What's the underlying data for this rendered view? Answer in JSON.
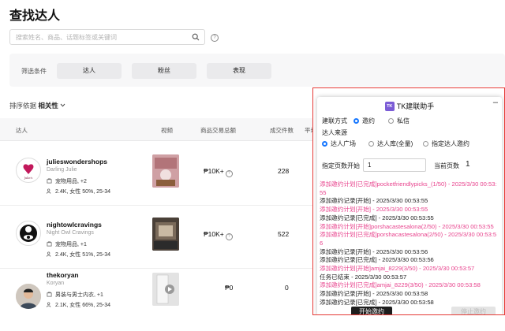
{
  "page": {
    "title": "查找达人"
  },
  "search": {
    "placeholder": "搜索姓名、商品、话题标签或关键词"
  },
  "filters": {
    "label": "筛选条件",
    "buttons": [
      "达人",
      "粉丝",
      "表现"
    ]
  },
  "sort": {
    "label": "排序依据",
    "value": "相关性"
  },
  "table": {
    "headers": [
      "达人",
      "视频",
      "商品交易总额",
      "成交件数",
      "平均"
    ],
    "rows": [
      {
        "handle": "julieswondershops",
        "nickname": "Darling Julie",
        "category": "宠物用品, +2",
        "audience": "2.4K, 女性 50%, 25-34",
        "gmv": "₱10K+",
        "units": "228"
      },
      {
        "handle": "nightowlcravings",
        "nickname": "Night Owl Cravings",
        "category": "宠物用品, +1",
        "audience": "2.4K, 女性 51%, 25-34",
        "gmv": "₱10K+",
        "units": "522"
      },
      {
        "handle": "thekoryan",
        "nickname": "Koryan",
        "category": "男装与男士内衣, +1",
        "audience": "2.1K, 女性 66%, 25-34",
        "gmv": "₱0",
        "units": "0"
      }
    ]
  },
  "extension": {
    "logo": "TK",
    "title": "TK建联助手",
    "minimize": "–",
    "method_label": "建联方式",
    "method_options": [
      "邀约",
      "私信"
    ],
    "source_label": "达人来源",
    "source_options": [
      "达人广场",
      "达人库(全量)",
      "指定达人邀约"
    ],
    "page_start_label": "指定页数开始",
    "page_start_value": "1",
    "current_page_label": "当前页数",
    "current_page_value": "1",
    "log": [
      {
        "text": "添加邀约计划[已完成]pocketfriendlypicks_(1/50) - 2025/3/30 00:53:55",
        "color": "pink"
      },
      {
        "text": "添加邀约记录[开始] - 2025/3/30 00:53:55",
        "color": "dark"
      },
      {
        "text": "添加邀约计划[开始] - 2025/3/30 00:53:55",
        "color": "pink"
      },
      {
        "text": "添加邀约记录[已完成] - 2025/3/30 00:53:55",
        "color": "dark"
      },
      {
        "text": "添加邀约计划[开始]porshacastesalona(2/50) - 2025/3/30 00:53:55",
        "color": "pink"
      },
      {
        "text": "添加邀约计划[已完成]porshacastesalona(2/50) - 2025/3/30 00:53:56",
        "color": "pink"
      },
      {
        "text": "添加邀约记录[开始] - 2025/3/30 00:53:56",
        "color": "dark"
      },
      {
        "text": "添加邀约记录[已完成] - 2025/3/30 00:53:56",
        "color": "dark"
      },
      {
        "text": "添加邀约计划[开始]amjai_8229(3/50) - 2025/3/30 00:53:57",
        "color": "pink"
      },
      {
        "text": "任务已结束 - 2025/3/30 00:53:57",
        "color": "dark"
      },
      {
        "text": "添加邀约计划[已完成]amjai_8229(3/50) - 2025/3/30 00:53:58",
        "color": "pink"
      },
      {
        "text": "添加邀约记录[开始] - 2025/3/30 00:53:58",
        "color": "dark"
      },
      {
        "text": "添加邀约记录[已完成] - 2025/3/30 00:53:58",
        "color": "dark"
      }
    ],
    "start_button": "开始邀约",
    "stop_button": "停止邀约"
  },
  "colors": {
    "accent": "#1677ff",
    "log_pink": "#e8448e",
    "panel_border": "#e53935"
  }
}
